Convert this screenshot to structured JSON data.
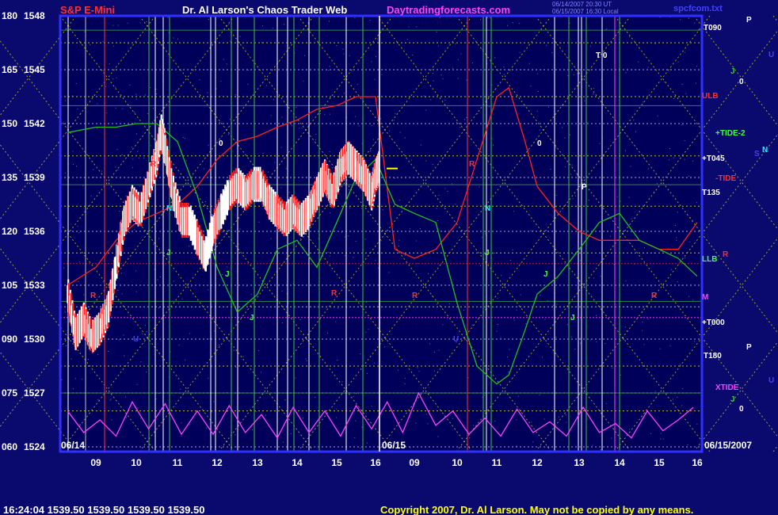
{
  "header": {
    "instrument": "S&P E-Mini",
    "title": "Dr. Al Larson's Chaos Trader Web",
    "site": "Daytradingforecasts.com",
    "timestamp_line1": "06/14/2007 20:30 UT",
    "timestamp_line2": "06/15/2007 16:30 Local",
    "file": "spcfcom.txt"
  },
  "footer": {
    "quote": "16:24:04  1539.50  1539.50  1539.50  1539.50",
    "copyright": "Copyright 2007, Dr. Al Larson. May not be copied by any means."
  },
  "colors": {
    "background": "#0a0a6e",
    "plot_background": "#00005a",
    "frame": "#3030ff",
    "price_up": "#ffffff",
    "price_down": "#ff2020",
    "ulb": "#ff2020",
    "llb": "#20c020",
    "xtide": "#ff40ff",
    "grid_yellow": "#e0e000",
    "forecast_yellow": "#ffff00"
  },
  "chart_data": {
    "type": "line",
    "title": "S&P E-Mini",
    "y_left_index_ticks": [
      "180",
      "165",
      "150",
      "135",
      "120",
      "105",
      "090",
      "075",
      "060"
    ],
    "y_price_ticks": [
      1548,
      1545,
      1542,
      1539,
      1536,
      1533,
      1530,
      1527,
      1524
    ],
    "ylim": [
      1524,
      1548
    ],
    "x_date_labels": [
      "06/14",
      "06/15",
      "06/15/2007"
    ],
    "x_hour_ticks": [
      "09",
      "10",
      "11",
      "12",
      "13",
      "14",
      "15",
      "16",
      "09",
      "10",
      "11",
      "12",
      "13",
      "14",
      "15",
      "16"
    ],
    "right_labels": [
      "T090",
      "T 0",
      "ULB",
      "+TIDE-2",
      "+T045",
      "-TIDE",
      "T135",
      "LLB",
      "M",
      "+T000",
      "T180",
      "XTIDE"
    ],
    "far_right_markers": [
      "P",
      "U",
      "J",
      "0",
      "S",
      "N",
      "R",
      "P",
      "U",
      "J",
      "0"
    ],
    "last_price": 1539.5,
    "series": [
      {
        "name": "S&P E-Mini",
        "x": [
          8.3,
          8.5,
          8.7,
          8.9,
          9.1,
          9.3,
          9.5,
          9.7,
          9.9,
          10.1,
          10.3,
          10.5,
          10.6,
          10.7,
          10.9,
          11.1,
          11.3,
          11.5,
          11.7,
          11.9,
          12.1,
          12.3,
          12.5,
          12.7,
          12.9,
          13.1,
          13.3,
          13.5,
          13.7,
          13.9,
          14.1,
          14.3,
          14.5,
          14.7,
          14.9,
          15.1,
          15.3,
          15.5,
          15.7,
          15.9,
          16.0,
          16.1
        ],
        "y": [
          1532.5,
          1530.2,
          1531.0,
          1530.0,
          1530.5,
          1531.5,
          1534.0,
          1536.5,
          1537.5,
          1537.0,
          1538.5,
          1540.0,
          1541.5,
          1540.5,
          1538.0,
          1536.5,
          1536.5,
          1535.5,
          1534.5,
          1536.0,
          1537.0,
          1538.0,
          1538.5,
          1538.0,
          1538.5,
          1538.5,
          1537.5,
          1537.0,
          1536.5,
          1537.0,
          1536.5,
          1537.0,
          1538.0,
          1539.0,
          1538.0,
          1539.5,
          1540.0,
          1539.5,
          1539.0,
          1538.0,
          1539.0,
          1539.5
        ]
      },
      {
        "name": "ULB",
        "x": [
          8.3,
          9.0,
          9.5,
          10.0,
          10.5,
          11.0,
          11.5,
          12.0,
          12.5,
          13.0,
          13.5,
          14.0,
          14.5,
          15.0,
          15.5,
          16.0,
          16.5,
          17.0,
          17.5,
          18.0,
          18.5,
          19.0,
          19.3,
          19.7,
          20.0,
          20.5,
          21.0,
          21.5,
          22.0,
          22.5,
          23.0,
          23.5,
          24.0
        ],
        "y": [
          1533.0,
          1534.0,
          1535.5,
          1536.5,
          1537.0,
          1537.5,
          1538.5,
          1540.0,
          1541.0,
          1541.3,
          1541.8,
          1542.2,
          1542.8,
          1543.0,
          1543.5,
          1543.5,
          1535.0,
          1534.5,
          1535.0,
          1536.5,
          1540.0,
          1543.5,
          1544.0,
          1541.0,
          1538.5,
          1537.0,
          1536.0,
          1535.5,
          1535.5,
          1535.5,
          1535.0,
          1535.0,
          1536.5
        ]
      },
      {
        "name": "LLB",
        "x": [
          8.3,
          9.0,
          9.5,
          10.0,
          10.5,
          11.0,
          11.5,
          12.0,
          12.5,
          13.0,
          13.5,
          14.0,
          14.5,
          15.0,
          15.5,
          16.0,
          16.5,
          17.0,
          17.5,
          18.0,
          18.5,
          19.0,
          19.3,
          19.7,
          20.0,
          20.5,
          21.0,
          21.5,
          22.0,
          22.5,
          23.0,
          23.5,
          24.0
        ],
        "y": [
          1541.5,
          1541.8,
          1541.8,
          1542.0,
          1542.0,
          1541.0,
          1538.0,
          1534.0,
          1531.5,
          1532.5,
          1535.0,
          1535.5,
          1534.0,
          1536.5,
          1539.0,
          1540.0,
          1537.5,
          1537.0,
          1536.5,
          1532.0,
          1528.5,
          1527.5,
          1528.0,
          1530.5,
          1532.5,
          1533.5,
          1535.0,
          1536.5,
          1537.0,
          1535.5,
          1535.0,
          1534.5,
          1533.5
        ]
      },
      {
        "name": "XTIDE",
        "x": [
          8.3,
          8.7,
          9.1,
          9.5,
          9.9,
          10.3,
          10.7,
          11.1,
          11.5,
          11.9,
          12.3,
          12.7,
          13.1,
          13.5,
          13.9,
          14.3,
          14.7,
          15.1,
          15.5,
          15.9,
          16.3,
          16.7,
          17.1,
          17.5,
          17.9,
          18.3,
          18.7,
          19.1,
          19.5,
          19.9,
          20.3,
          20.7,
          21.1,
          21.5,
          21.9,
          22.3,
          22.7,
          23.1,
          23.5,
          23.9
        ],
        "y": [
          1526.0,
          1524.8,
          1525.5,
          1524.6,
          1526.5,
          1525.0,
          1526.4,
          1524.7,
          1526.0,
          1524.7,
          1526.3,
          1524.8,
          1525.8,
          1524.5,
          1526.2,
          1524.8,
          1526.0,
          1524.6,
          1526.3,
          1525.0,
          1526.5,
          1524.8,
          1527.0,
          1525.2,
          1526.0,
          1524.7,
          1525.6,
          1524.6,
          1526.1,
          1524.8,
          1525.4,
          1524.6,
          1526.2,
          1524.8,
          1525.3,
          1524.5,
          1526.0,
          1524.9,
          1525.5,
          1526.2
        ]
      }
    ]
  }
}
